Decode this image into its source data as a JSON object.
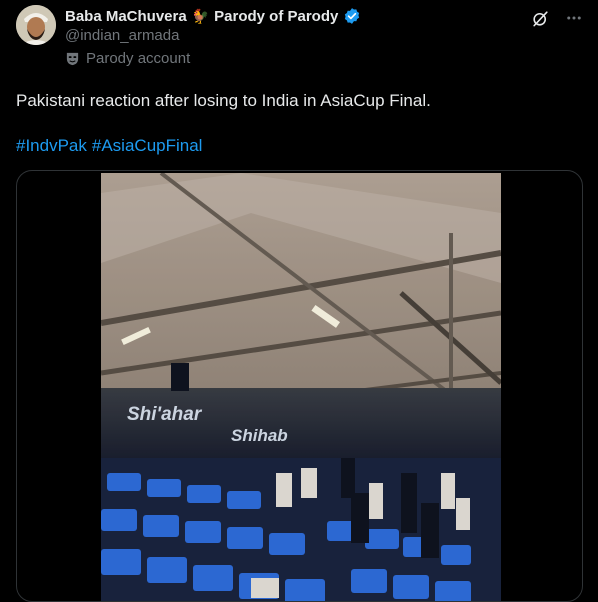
{
  "author": {
    "name": "Baba MaChuvera",
    "name_emoji": "🐓",
    "name_suffix": "Parody of Parody",
    "handle": "@indian_armada",
    "label": "Parody account"
  },
  "icons": {
    "avatar": "avatar-image",
    "verified": "verified-badge-icon",
    "grok": "grok-icon",
    "more": "more-options-icon",
    "mask": "parody-mask-icon"
  },
  "tweet": {
    "text": "Pakistani reaction after losing to India in AsiaCup Final.",
    "hashtags": [
      "#IndvPak",
      "#AsiaCupFinal"
    ]
  },
  "media": {
    "signage_1": "Shi'ahar",
    "signage_2": "Shihab"
  },
  "colors": {
    "background": "#000000",
    "text": "#e7e9ea",
    "secondary": "#71767b",
    "link": "#1d9bf0",
    "verified": "#1d9bf0",
    "seat_blue": "#2f6fe0"
  }
}
